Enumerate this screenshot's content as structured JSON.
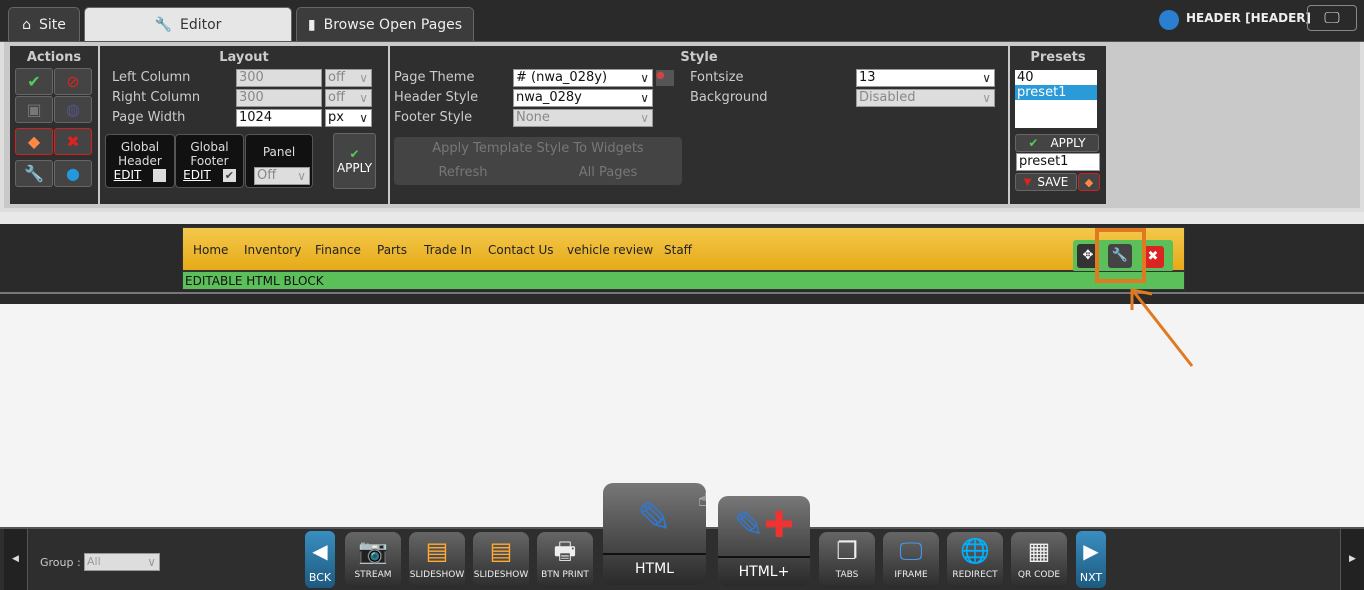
{
  "tabs": [
    {
      "label": "Site",
      "icon": "home-icon"
    },
    {
      "label": "Editor",
      "icon": "wrench-icon",
      "active": true
    },
    {
      "label": "Browse Open Pages",
      "icon": "pages-icon"
    }
  ],
  "context": {
    "label": "HEADER [HEADER]"
  },
  "actions": {
    "title": "Actions"
  },
  "layout": {
    "title": "Layout",
    "left_column": {
      "label": "Left Column",
      "value": "300",
      "unit": "off"
    },
    "right_column": {
      "label": "Right Column",
      "value": "300",
      "unit": "off"
    },
    "page_width": {
      "label": "Page Width",
      "value": "1024",
      "unit": "px"
    },
    "global_header": {
      "label1": "Global",
      "label2": "Header",
      "edit": "EDIT",
      "checked": false
    },
    "global_footer": {
      "label1": "Global",
      "label2": "Footer",
      "edit": "EDIT",
      "checked": true
    },
    "panel": {
      "label": "Panel",
      "value": "Off"
    },
    "apply": "APPLY"
  },
  "style": {
    "title": "Style",
    "page_theme": {
      "label": "Page Theme",
      "value": "# (nwa_028y)"
    },
    "header_style": {
      "label": "Header Style",
      "value": "nwa_028y"
    },
    "footer_style": {
      "label": "Footer Style",
      "value": "None"
    },
    "fontsize": {
      "label": "Fontsize",
      "value": "13"
    },
    "background": {
      "label": "Background",
      "value": "Disabled"
    },
    "apply_template": "Apply Template Style To Widgets",
    "refresh": "Refresh",
    "all_pages": "All Pages"
  },
  "presets": {
    "title": "Presets",
    "items": [
      "40",
      "preset1"
    ],
    "selected": "preset1",
    "apply": "APPLY",
    "name_value": "preset1",
    "save": "SAVE"
  },
  "header_nav": [
    "Home",
    "Inventory",
    "Finance",
    "Parts",
    "Trade In",
    "Contact Us",
    "vehicle review",
    "Staff"
  ],
  "editable_block": "EDITABLE HTML BLOCK",
  "bottom": {
    "group_label": "Group :",
    "group_value": "All",
    "back": "BCK",
    "next": "NXT",
    "widgets_left": [
      {
        "label": "STREAM",
        "icon": "webcam-icon"
      },
      {
        "label": "SLIDESHOW",
        "icon": "slideshow-icon"
      },
      {
        "label": "SLIDESHOW",
        "icon": "slideshow-icon"
      },
      {
        "label": "BTN PRINT",
        "icon": "printer-icon"
      }
    ],
    "html": "HTML",
    "html_plus": "HTML+",
    "widgets_right": [
      {
        "label": "TABS",
        "icon": "tabs-icon"
      },
      {
        "label": "IFRAME",
        "icon": "monitor-icon"
      },
      {
        "label": "REDIRECT",
        "icon": "globe-arrow-icon"
      },
      {
        "label": "QR CODE",
        "icon": "qr-code-icon"
      }
    ]
  },
  "colors": {
    "highlight": "#e07a20",
    "editable_block": "#5cc05a",
    "header_bg": "#f0bc30",
    "selection": "#2a9ad8"
  }
}
